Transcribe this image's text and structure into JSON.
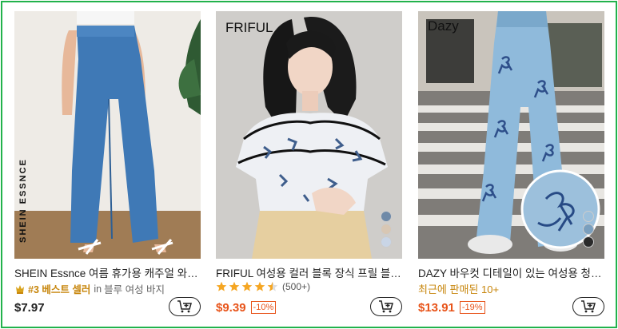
{
  "products": [
    {
      "brand_watermark": "SHEIN ESSNCE",
      "title": "SHEIN Essnce 여름 휴가용 캐주얼 와이드 팬츠",
      "badge": {
        "rank": "#3 베스트 셀러",
        "in": "in",
        "category": "블루 여성 바지",
        "icon": "crown-icon"
      },
      "price": "$7.97",
      "discount": "",
      "cart_icon": "add-to-cart-icon"
    },
    {
      "brand_watermark": "FRIFUL",
      "title": "FRIFUL 여성용 컬러 블록 장식 프릴 블라우스",
      "rating": {
        "stars": 4.5,
        "count": "(500+)"
      },
      "price": "$9.39",
      "discount": "-10%",
      "swatches": [
        "#6f8aa8",
        "#d8c7b4",
        "#c9d5e6"
      ],
      "cart_icon": "add-to-cart-icon"
    },
    {
      "brand_watermark": "Dazy",
      "title": "DAZY 바우컷 디테일이 있는 여성용 청바지",
      "recent": "최근에 판매된 10+",
      "price": "$13.91",
      "discount": "-19%",
      "swatches": [
        "#9cc0dc",
        "#7a9fbe",
        "#2b2b2b"
      ],
      "cart_icon": "add-to-cart-icon"
    }
  ],
  "colors": {
    "frame_border": "#22b24c",
    "sale_price": "#e8541a",
    "best_seller": "#c7850a",
    "star": "#f5a623"
  }
}
